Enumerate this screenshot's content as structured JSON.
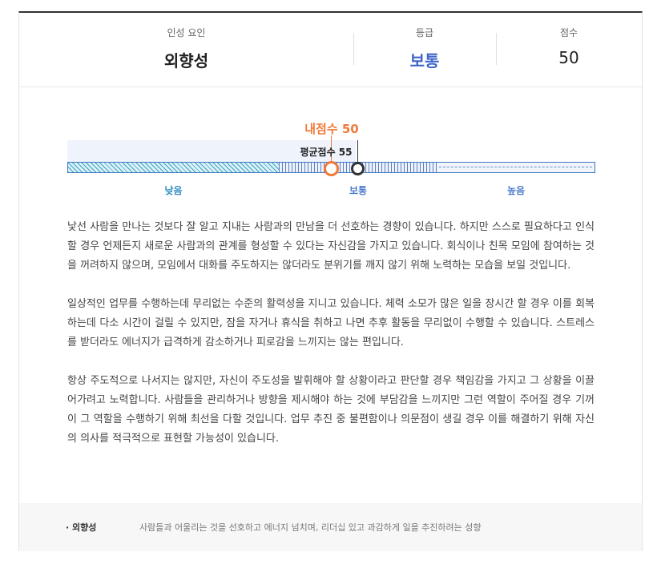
{
  "header": {
    "factor_label": "인성 요인",
    "factor_value": "외향성",
    "grade_label": "등급",
    "grade_value": "보통",
    "score_label": "점수",
    "score_value": "50"
  },
  "chart": {
    "my_score_label": "내점수 50",
    "avg_score_label": "평균점수 55",
    "my_score": 50,
    "avg_score": 55,
    "segments": [
      "낮음",
      "보통",
      "높음"
    ],
    "colors": {
      "my": "#f07a3a",
      "avg": "#333333",
      "grade": "#3f66c8"
    }
  },
  "paragraphs": [
    "낯선 사람을 만나는 것보다 잘 알고 지내는 사람과의 만남을 더 선호하는 경향이 있습니다. 하지만 스스로 필요하다고 인식할 경우 언제든지 새로운 사람과의 관계를 형성할 수 있다는 자신감을 가지고 있습니다. 회식이나 친목 모임에 참여하는 것을 꺼려하지 않으며, 모임에서 대화를 주도하지는 않더라도 분위기를 깨지 않기 위해 노력하는 모습을 보일 것입니다.",
    "일상적인 업무를 수행하는데 무리없는 수준의 활력성을 지니고 있습니다. 체력 소모가 많은 일을 장시간 할 경우 이를 회복하는데 다소 시간이 걸릴 수 있지만, 잠을 자거나 휴식을 취하고 나면 추후 활동을 무리없이 수행할 수 있습니다. 스트레스를 받더라도 에너지가 급격하게 감소하거나 피로감을 느끼지는 않는 편입니다.",
    "항상 주도적으로 나서지는 않지만, 자신이 주도성을 발휘해야 할 상황이라고 판단할 경우 책임감을 가지고 그 상황을 이끌어가려고 노력합니다. 사람들을 관리하거나 방향을 제시해야 하는 것에 부담감을 느끼지만 그런 역할이 주어질 경우 기꺼이 그 역할을 수행하기 위해 최선을 다할 것입니다. 업무 추진 중 불편함이나 의문점이 생길 경우 이를 해결하기 위해 자신의 의사를 적극적으로 표현할 가능성이 있습니다."
  ],
  "footer": {
    "name": "· 외향성",
    "description": "사람들과 어울리는 것을 선호하고 에너지 넘치며, 리더십 있고 과감하게 일을 추진하려는 성향"
  }
}
